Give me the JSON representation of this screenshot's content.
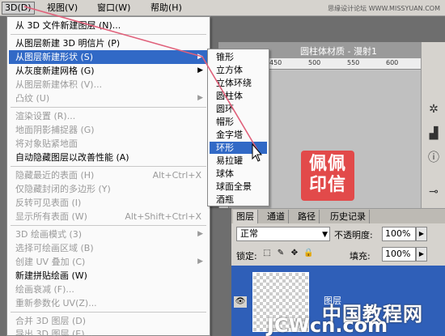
{
  "menubar": {
    "items": [
      "3D(D)",
      "视图(V)",
      "窗口(W)",
      "帮助(H)"
    ],
    "watermark": "思缘设计论坛 WWW.MISSYUAN.COM"
  },
  "document": {
    "tab_title": "圆柱体材质 - 漫射1",
    "ruler_numbers": [
      "450",
      "500",
      "550",
      "600"
    ],
    "seal_text": "佩佩\n印信"
  },
  "menu": {
    "items": [
      {
        "label": "从 3D 文件新建图层 (N)...",
        "shortcut": "",
        "disabled": false
      },
      {
        "label": "从图层新建 3D 明信片 (P)",
        "shortcut": "",
        "disabled": false
      },
      {
        "label": "从图层新建形状 (S)",
        "shortcut": "",
        "disabled": false
      },
      {
        "label": "从灰度新建网格 (G)",
        "shortcut": "",
        "disabled": false
      },
      {
        "label": "从图层新建体积 (V)...",
        "shortcut": "",
        "disabled": true
      },
      {
        "label": "凸纹 (U)",
        "shortcut": "",
        "disabled": true
      },
      {
        "label": "渲染设置 (R)...",
        "shortcut": "",
        "disabled": true
      },
      {
        "label": "地面阴影捕捉器 (G)",
        "shortcut": "",
        "disabled": true
      },
      {
        "label": "将对象贴紧地面",
        "shortcut": "",
        "disabled": true
      },
      {
        "label": "自动隐藏图层以改善性能 (A)",
        "shortcut": "",
        "disabled": false
      },
      {
        "label": "隐藏最近的表面 (H)",
        "shortcut": "Alt+Ctrl+X",
        "disabled": true
      },
      {
        "label": "仅隐藏封闭的多边形 (Y)",
        "shortcut": "",
        "disabled": true
      },
      {
        "label": "反转可见表面 (I)",
        "shortcut": "",
        "disabled": true
      },
      {
        "label": "显示所有表面 (W)",
        "shortcut": "Alt+Shift+Ctrl+X",
        "disabled": true
      },
      {
        "label": "3D 绘画模式 (3)",
        "shortcut": "",
        "disabled": true
      },
      {
        "label": "选择可绘画区域 (B)",
        "shortcut": "",
        "disabled": true
      },
      {
        "label": "创建 UV 叠加 (C)",
        "shortcut": "",
        "disabled": true
      },
      {
        "label": "新建拼贴绘画 (W)",
        "shortcut": "",
        "disabled": false
      },
      {
        "label": "绘画衰减 (F)...",
        "shortcut": "",
        "disabled": true
      },
      {
        "label": "重新参数化 UV(Z)...",
        "shortcut": "",
        "disabled": true
      },
      {
        "label": "合并 3D 图层 (D)",
        "shortcut": "",
        "disabled": true
      },
      {
        "label": "导出 3D 图层 (E)...",
        "shortcut": "",
        "disabled": true
      }
    ]
  },
  "submenu": {
    "items": [
      "锥形",
      "立方体",
      "立体环绕",
      "圆柱体",
      "圆环",
      "帽形",
      "金字塔",
      "环形",
      "易拉罐",
      "球体",
      "球面全景",
      "酒瓶"
    ],
    "highlighted": "环形"
  },
  "layers": {
    "tabs": [
      "图层",
      "通道",
      "路径",
      "历史记录"
    ],
    "blend_mode": "正常",
    "opacity_label": "不透明度:",
    "opacity_value": "100%",
    "lock_label": "锁定:",
    "fill_label": "填充:",
    "fill_value": "100%",
    "layer_name": "图层"
  },
  "brand": {
    "line1": "中国教程网",
    "line2": "JCWcn.com"
  },
  "colors": {
    "highlight": "#3169c6",
    "annotation": "#e0607a",
    "seal": "#e24a4a"
  }
}
